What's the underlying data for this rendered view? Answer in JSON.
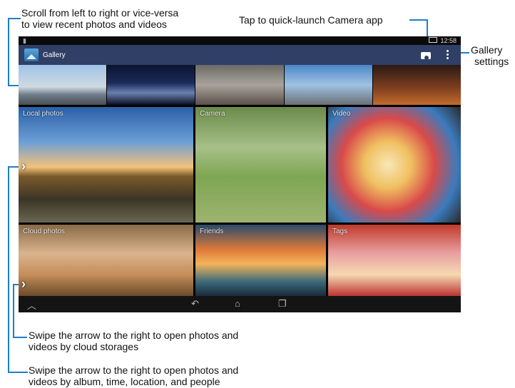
{
  "callouts": {
    "scroll_line1": "Scroll from left to right or vice-versa",
    "scroll_line2": "to view recent photos and videos",
    "camera": "Tap to quick-launch Camera app",
    "settings_line1": "Gallery",
    "settings_line2": "settings",
    "cloud_line1": "Swipe the arrow to the right to open photos and",
    "cloud_line2": "videos by cloud storages",
    "album_line1": "Swipe the arrow to the right to open photos and",
    "album_line2": "videos by album, time, location, and people"
  },
  "status_bar": {
    "time": "12:58"
  },
  "action_bar": {
    "title": "Gallery"
  },
  "tiles": {
    "local": "Local photos",
    "camera": "Camera",
    "video": "Video",
    "cloud": "Cloud photos",
    "friends": "Friends",
    "tags": "Tags"
  },
  "glyphs": {
    "arrow": "›"
  },
  "colors": {
    "callout_line": "#1e7fc6",
    "action_bar": "#2f3f66",
    "nav_bar": "#141414"
  },
  "icons": [
    "gallery-app-icon",
    "camera-icon",
    "overflow-menu-icon",
    "back-icon",
    "home-icon",
    "recent-apps-icon",
    "chevron-up-icon"
  ]
}
